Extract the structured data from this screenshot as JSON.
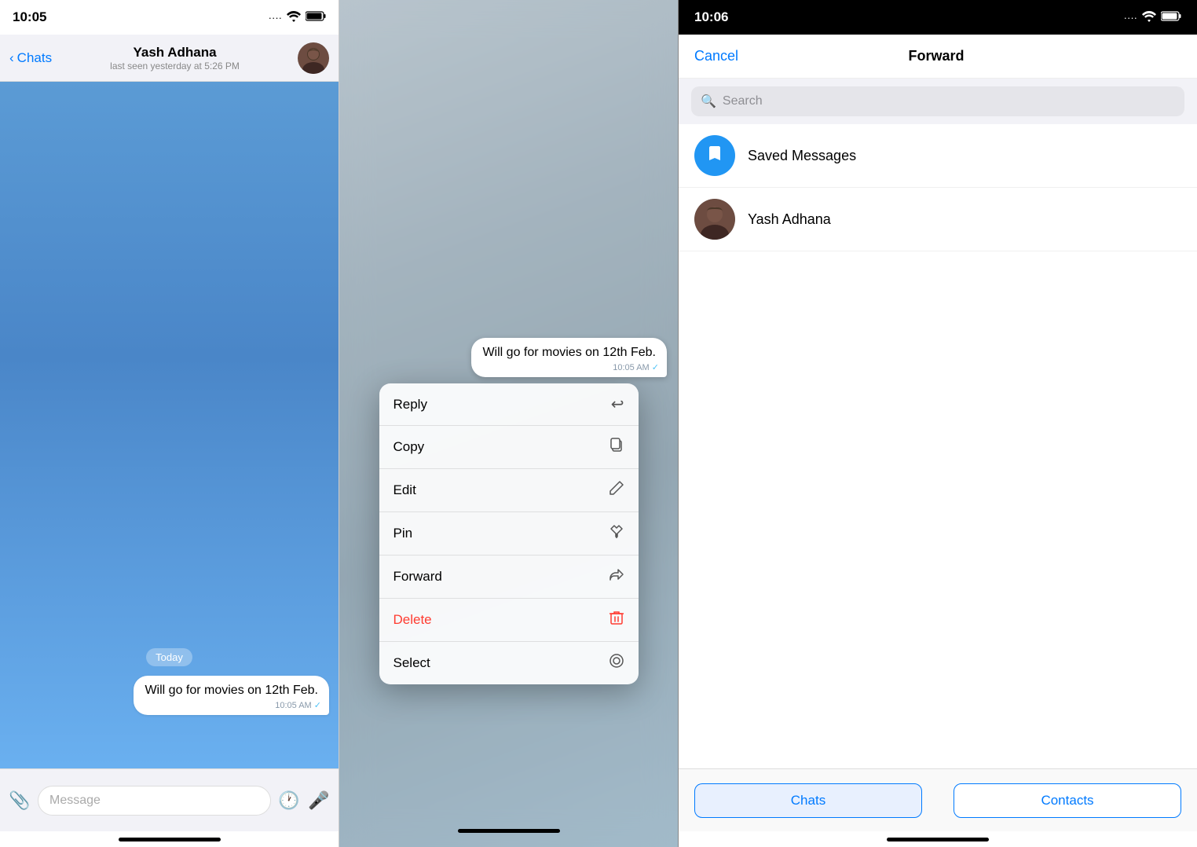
{
  "panel1": {
    "status_time": "10:05",
    "status_signal": "···· ",
    "status_wifi": "WiFi",
    "status_battery": "🔋",
    "nav_back": "Chats",
    "contact_name": "Yash Adhana",
    "contact_status": "last seen yesterday at 5:26 PM",
    "date_label": "Today",
    "message_text": "Will go for movies on 12th Feb.",
    "message_time": "10:05 AM",
    "input_placeholder": "Message"
  },
  "panel2": {
    "message_text": "Will go for movies on 12th Feb.",
    "message_time": "10:05 AM",
    "menu_items": [
      {
        "label": "Reply",
        "icon": "↩",
        "delete": false
      },
      {
        "label": "Copy",
        "icon": "⧉",
        "delete": false
      },
      {
        "label": "Edit",
        "icon": "✏",
        "delete": false
      },
      {
        "label": "Pin",
        "icon": "⚲",
        "delete": false
      },
      {
        "label": "Forward",
        "icon": "↪",
        "delete": false
      },
      {
        "label": "Delete",
        "icon": "🗑",
        "delete": true
      },
      {
        "label": "Select",
        "icon": "◎",
        "delete": false
      }
    ]
  },
  "panel3": {
    "status_time": "10:06",
    "cancel_label": "Cancel",
    "title": "Forward",
    "search_placeholder": "Search",
    "contacts": [
      {
        "name": "Saved Messages",
        "type": "saved"
      },
      {
        "name": "Yash Adhana",
        "type": "user"
      }
    ],
    "tab_chats": "Chats",
    "tab_contacts": "Contacts"
  }
}
